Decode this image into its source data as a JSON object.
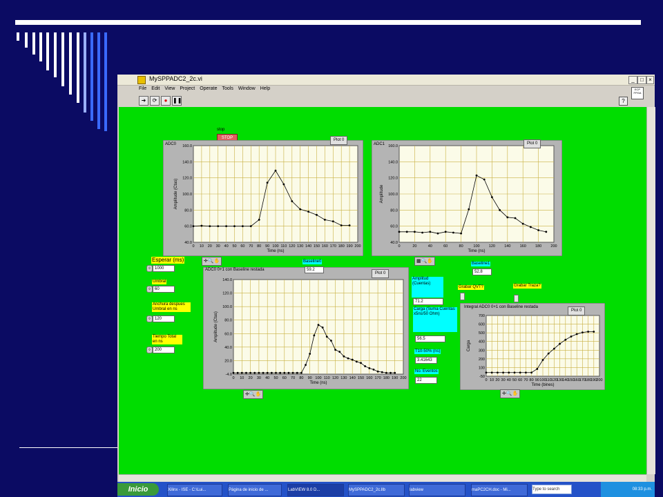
{
  "window": {
    "title": "MySPPADC2_2c.vi",
    "menu": [
      "File",
      "Edit",
      "View",
      "Project",
      "Operate",
      "Tools",
      "Window",
      "Help"
    ],
    "fpga_badge": "ECP FPGA"
  },
  "controls": {
    "stop_label": "stop",
    "stop_button": "STOP",
    "esperar_label": "Esperar (ms)",
    "esperar_value": "1000",
    "umbral_label": "Umbral",
    "umbral_value": "60",
    "anchura_label": "Anchura despues Umbral en ns",
    "anchura_value": "120",
    "tiempo_label": "Tiempo Total en ns",
    "tiempo_value": "200",
    "baseline0_label": "Baseline0",
    "baseline0_value": "59.2",
    "baseline1_label": "Baseline1",
    "baseline1_value": "52.8",
    "amplitud_label": "Amplitud (Cuentas)",
    "amplitud_value": "71.2",
    "carga_label": "Carga (Suma Cuentas x5ns/50 Ohm)",
    "carga_value": "56.5",
    "t10_label": "T10-50% (ns)",
    "t10_value": "3.41643",
    "eventos_label": "No. Eventos",
    "eventos_value": "22",
    "grabar_qvt": "Grabar QVT?",
    "grabar_traza": "Grabar Traza?"
  },
  "taskbar": {
    "start": "Inicio",
    "tasks": [
      "Xilinx - ISE - C:\\Lui...",
      "Página de inicio de ...",
      "LabVIEW 8.0 D...",
      "MySPPADC2_2c.llb",
      "labview",
      "maPC2CH.doc - Mi..."
    ],
    "search": "Type to search",
    "clock": "08:33 p.m."
  },
  "accent_colors": {
    "panel": "#00dd00",
    "slide_bg": "#0b0b63",
    "indicator_yellow": "#ffff00",
    "indicator_cyan": "#00ffff"
  },
  "chart_data": [
    {
      "type": "line",
      "title": "ADC0",
      "legend": "Plot 0",
      "xlabel": "Time (ns)",
      "ylabel": "Amplitude (Ctas)",
      "xlim": [
        0,
        200
      ],
      "ylim": [
        40,
        160
      ],
      "xticks": [
        "0",
        "10",
        "20",
        "30",
        "40",
        "50",
        "60",
        "70",
        "80",
        "90",
        "100",
        "110",
        "120",
        "130",
        "140",
        "150",
        "160",
        "170",
        "180",
        "190",
        "200"
      ],
      "yticks": [
        "40.0",
        "60.0",
        "80.0",
        "100.0",
        "120.0",
        "140.0",
        "160.0"
      ],
      "x": [
        0,
        10,
        20,
        30,
        40,
        50,
        60,
        70,
        80,
        90,
        100,
        110,
        120,
        130,
        140,
        150,
        160,
        170,
        180,
        190
      ],
      "y": [
        60,
        60.5,
        60,
        60,
        60,
        60,
        60,
        60,
        68,
        114,
        129,
        112,
        91,
        81,
        78,
        74,
        68,
        66,
        61,
        61
      ],
      "grid": true
    },
    {
      "type": "line",
      "title": "ADC1",
      "legend": "Plot 0",
      "xlabel": "Time (ns)",
      "ylabel": "Amplitude",
      "xlim": [
        0,
        200
      ],
      "ylim": [
        40,
        160
      ],
      "xticks": [
        "0",
        "20",
        "40",
        "60",
        "80",
        "100",
        "120",
        "140",
        "160",
        "180",
        "200"
      ],
      "yticks": [
        "40.0",
        "60.0",
        "80.0",
        "100.0",
        "120.0",
        "140.0",
        "160.0"
      ],
      "x": [
        0,
        10,
        20,
        30,
        40,
        50,
        60,
        70,
        80,
        90,
        100,
        110,
        120,
        130,
        140,
        150,
        160,
        170,
        180,
        190
      ],
      "y": [
        53,
        53,
        53,
        52,
        53,
        51,
        53,
        52,
        51,
        81,
        123,
        118,
        96,
        80,
        71,
        70,
        63,
        59,
        55,
        53
      ],
      "grid": true
    },
    {
      "type": "line",
      "title": "ADC0 0+1 con Baseline restada",
      "legend": "Plot 0",
      "xlabel": "Time (ns)",
      "ylabel": "Amplitude (Ctas)",
      "xlim": [
        0,
        200
      ],
      "ylim": [
        -4,
        140
      ],
      "xticks": [
        "0",
        "10",
        "20",
        "30",
        "40",
        "50",
        "60",
        "70",
        "80",
        "90",
        "100",
        "110",
        "120",
        "130",
        "140",
        "150",
        "160",
        "170",
        "180",
        "190",
        "200"
      ],
      "yticks": [
        "-4.0",
        "20.0",
        "40.0",
        "60.0",
        "80.0",
        "100.0",
        "120.0",
        "140.0"
      ],
      "x": [
        0,
        5,
        10,
        15,
        20,
        25,
        30,
        35,
        40,
        45,
        50,
        55,
        60,
        65,
        70,
        75,
        80,
        85,
        90,
        95,
        100,
        105,
        110,
        115,
        120,
        125,
        130,
        135,
        140,
        145,
        150,
        155,
        160,
        165,
        170,
        175,
        180,
        185,
        190
      ],
      "y": [
        -2,
        -2,
        -2,
        -2,
        -2,
        -2,
        -2,
        -2,
        -2,
        -2,
        -2,
        -2,
        -2,
        -2,
        -2,
        -2,
        -2,
        10,
        27,
        55,
        71,
        67,
        53,
        47,
        33,
        30,
        23,
        20,
        18,
        15,
        13,
        8,
        5,
        3,
        0,
        -1,
        -2,
        -2,
        -2
      ],
      "grid": true
    },
    {
      "type": "line",
      "title": "Integral ADC0 0+1 con Baseline restada",
      "legend": "Plot 0",
      "xlabel": "Time (bines)",
      "ylabel": "Carga",
      "xlim": [
        0,
        200
      ],
      "ylim": [
        -50,
        700
      ],
      "xticks": [
        "0",
        "10",
        "20",
        "30",
        "40",
        "50",
        "60",
        "70",
        "80",
        "90",
        "100",
        "110",
        "120",
        "130",
        "140",
        "150",
        "160",
        "170",
        "180",
        "190",
        "200"
      ],
      "yticks": [
        "-50",
        "100",
        "200",
        "300",
        "400",
        "500",
        "600",
        "700"
      ],
      "x": [
        0,
        10,
        20,
        30,
        40,
        50,
        60,
        70,
        80,
        90,
        100,
        110,
        120,
        130,
        140,
        150,
        160,
        170,
        180,
        190
      ],
      "y": [
        -5,
        -5,
        -5,
        -5,
        -5,
        -5,
        -5,
        -5,
        -5,
        40,
        150,
        230,
        290,
        350,
        400,
        440,
        470,
        490,
        500,
        500
      ],
      "grid": true
    }
  ]
}
